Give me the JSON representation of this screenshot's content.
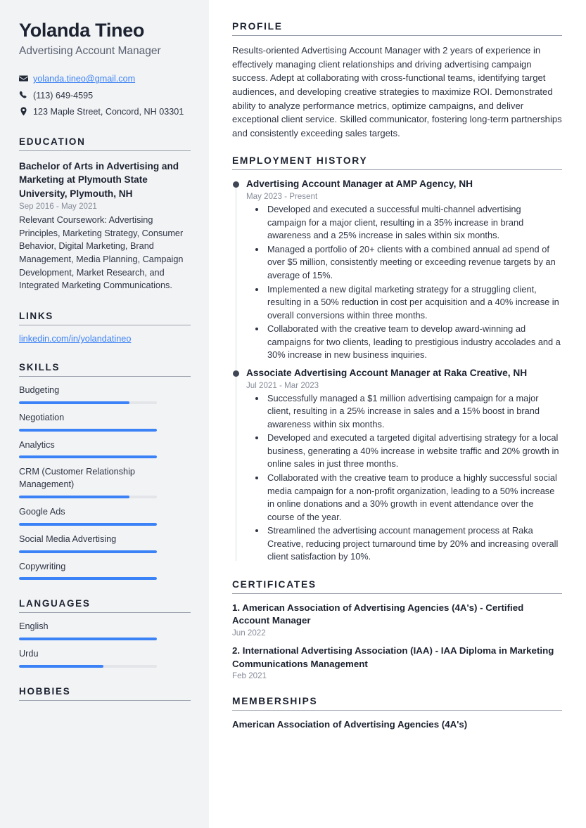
{
  "person": {
    "name": "Yolanda Tineo",
    "title": "Advertising Account Manager"
  },
  "contact": {
    "email": "yolanda.tineo@gmail.com",
    "phone": "(113) 649-4595",
    "address": "123 Maple Street, Concord, NH 03301",
    "icons": {
      "email": "envelope-icon",
      "phone": "phone-icon",
      "address": "map-pin-icon"
    }
  },
  "sidebar": {
    "education": {
      "heading": "EDUCATION",
      "degree": "Bachelor of Arts in Advertising and Marketing at Plymouth State University, Plymouth, NH",
      "date": "Sep 2016 - May 2021",
      "description": "Relevant Coursework: Advertising Principles, Marketing Strategy, Consumer Behavior, Digital Marketing, Brand Management, Media Planning, Campaign Development, Market Research, and Integrated Marketing Communications."
    },
    "links": {
      "heading": "LINKS",
      "items": [
        {
          "label": "linkedin.com/in/yolandatineo"
        }
      ]
    },
    "skills": {
      "heading": "SKILLS",
      "items": [
        {
          "label": "Budgeting",
          "level": 80
        },
        {
          "label": "Negotiation",
          "level": 100
        },
        {
          "label": "Analytics",
          "level": 100
        },
        {
          "label": "CRM (Customer Relationship Management)",
          "level": 80
        },
        {
          "label": "Google Ads",
          "level": 100
        },
        {
          "label": "Social Media Advertising",
          "level": 100
        },
        {
          "label": "Copywriting",
          "level": 100
        }
      ]
    },
    "languages": {
      "heading": "LANGUAGES",
      "items": [
        {
          "label": "English",
          "level": 100
        },
        {
          "label": "Urdu",
          "level": 61
        }
      ]
    },
    "hobbies": {
      "heading": "HOBBIES"
    }
  },
  "main": {
    "profile": {
      "heading": "PROFILE",
      "text": "Results-oriented Advertising Account Manager with 2 years of experience in effectively managing client relationships and driving advertising campaign success. Adept at collaborating with cross-functional teams, identifying target audiences, and developing creative strategies to maximize ROI. Demonstrated ability to analyze performance metrics, optimize campaigns, and deliver exceptional client service. Skilled communicator, fostering long-term partnerships and consistently exceeding sales targets."
    },
    "employment": {
      "heading": "EMPLOYMENT HISTORY",
      "jobs": [
        {
          "title": "Advertising Account Manager at AMP Agency, NH",
          "date": "May 2023 - Present",
          "bullets": [
            "Developed and executed a successful multi-channel advertising campaign for a major client, resulting in a 35% increase in brand awareness and a 25% increase in sales within six months.",
            "Managed a portfolio of 20+ clients with a combined annual ad spend of over $5 million, consistently meeting or exceeding revenue targets by an average of 15%.",
            "Implemented a new digital marketing strategy for a struggling client, resulting in a 50% reduction in cost per acquisition and a 40% increase in overall conversions within three months.",
            "Collaborated with the creative team to develop award-winning ad campaigns for two clients, leading to prestigious industry accolades and a 30% increase in new business inquiries."
          ]
        },
        {
          "title": "Associate Advertising Account Manager at Raka Creative, NH",
          "date": "Jul 2021 - Mar 2023",
          "bullets": [
            "Successfully managed a $1 million advertising campaign for a major client, resulting in a 25% increase in sales and a 15% boost in brand awareness within six months.",
            "Developed and executed a targeted digital advertising strategy for a local business, generating a 40% increase in website traffic and 20% growth in online sales in just three months.",
            "Collaborated with the creative team to produce a highly successful social media campaign for a non-profit organization, leading to a 50% increase in online donations and a 30% growth in event attendance over the course of the year.",
            "Streamlined the advertising account management process at Raka Creative, reducing project turnaround time by 20% and increasing overall client satisfaction by 10%."
          ]
        }
      ]
    },
    "certificates": {
      "heading": "CERTIFICATES",
      "items": [
        {
          "title": "1. American Association of Advertising Agencies (4A's) - Certified Account Manager",
          "date": "Jun 2022"
        },
        {
          "title": "2. International Advertising Association (IAA) - IAA Diploma in Marketing Communications Management",
          "date": "Feb 2021"
        }
      ]
    },
    "memberships": {
      "heading": "MEMBERSHIPS",
      "items": [
        {
          "label": "American Association of Advertising Agencies (4A's)"
        }
      ]
    }
  },
  "colors": {
    "accent": "#3b82f6",
    "sidebar_bg": "#f2f3f5",
    "heading": "#1c2230",
    "muted": "#868c99"
  }
}
